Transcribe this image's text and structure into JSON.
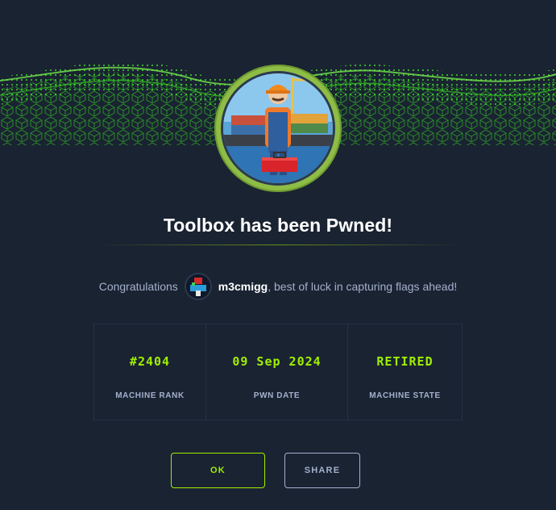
{
  "banner": {
    "description_icon": "green-cube-wave-icon"
  },
  "machine": {
    "avatar_icon": "worker-with-toolbox-icon"
  },
  "title": "Toolbox has been Pwned!",
  "congrats": {
    "prefix": "Congratulations",
    "username": "m3cmigg",
    "suffix": ", best of luck in capturing flags ahead!"
  },
  "stats": [
    {
      "value": "#2404",
      "label": "MACHINE RANK"
    },
    {
      "value": "09 Sep 2024",
      "label": "PWN DATE"
    },
    {
      "value": "RETIRED",
      "label": "MACHINE STATE"
    }
  ],
  "buttons": {
    "ok": "OK",
    "share": "SHARE"
  },
  "colors": {
    "background": "#1a2332",
    "accent": "#9fef00",
    "muted": "#a4b1cd",
    "ring": "#8ebd46"
  }
}
